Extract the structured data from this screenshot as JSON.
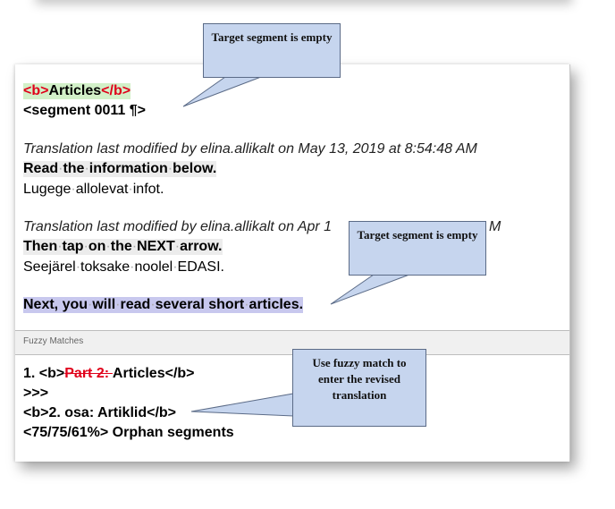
{
  "callouts": {
    "top": "Target segment is empty",
    "middle": "Target segment is empty",
    "bottom": "Use fuzzy match to enter the revised translation"
  },
  "editor": {
    "open_tag": "<b>",
    "heading_word": "Articles",
    "close_tag": "</b>",
    "segment_marker": "<segment 0011 ¶>",
    "mod1": "Translation last modified by elina.allikalt on May 13, 2019 at 8:54:48 AM",
    "source1": [
      "Read",
      "the",
      "information",
      "below."
    ],
    "target1": [
      "Lugege",
      "allolevat",
      "infot."
    ],
    "mod2": "Translation last modified by elina.allikalt on Apr 1",
    "mod2_tail": "M",
    "source2": [
      "Then",
      "tap",
      "on",
      "the",
      "NEXT",
      "arrow."
    ],
    "target2": [
      "Seejärel",
      "toksake",
      "noolel",
      "EDASI."
    ],
    "source3": [
      "Next,",
      "you",
      "will",
      "read",
      "several",
      "short",
      "articles."
    ]
  },
  "fuzzy": {
    "title": "Fuzzy Matches",
    "line1_prefix": "1. <b>",
    "line1_deleted": "Part 2: ",
    "line1_suffix": "Articles</b>",
    "line2": ">>>",
    "line3": "<b>2. osa: Artiklid</b>",
    "line4": "<75/75/61%> Orphan segments"
  },
  "colors": {
    "tag_red": "#e0001a",
    "callout_fill": "#c6d5ee",
    "source_highlight": "#ececec",
    "active_highlight": "#c8c8ee",
    "tag_highlight": "#d2f0c8"
  }
}
